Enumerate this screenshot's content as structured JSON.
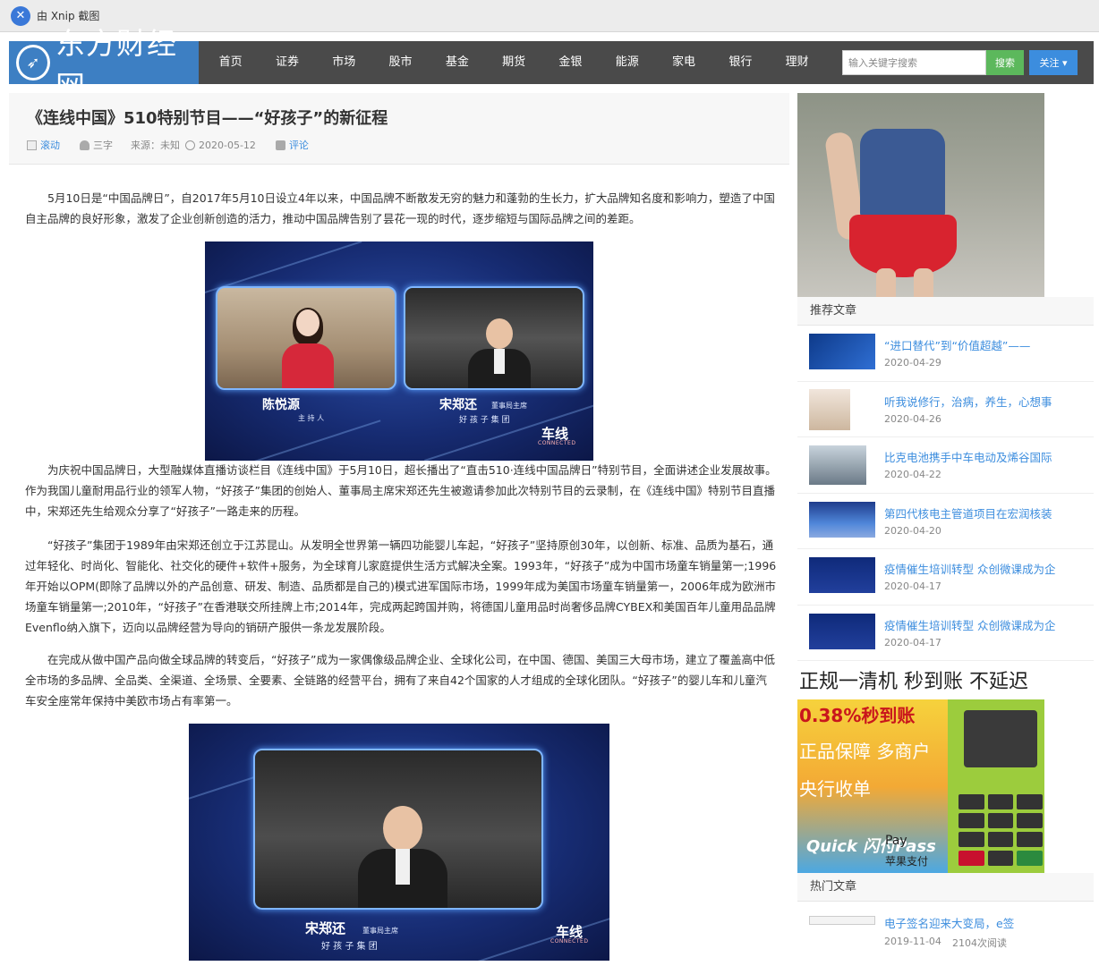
{
  "xnip": {
    "logo_glyph": "✕",
    "label": "由 Xnip 截图"
  },
  "site": {
    "logo_text": "东方财经网",
    "nav": [
      "首页",
      "证券",
      "市场",
      "股市",
      "基金",
      "期货",
      "金银",
      "能源",
      "家电",
      "银行",
      "理财"
    ],
    "search_placeholder": "输入关键字搜索",
    "search_label": "搜索",
    "follow_label": "关注 ▾"
  },
  "article": {
    "title": "《连线中国》510特别节目——“好孩子”的新征程",
    "meta": {
      "category": "滚动",
      "author": "三字",
      "source": "来源：未知",
      "date": "2020-05-12",
      "comment": "评论"
    },
    "paragraphs": [
      "5月10日是“中国品牌日”，自2017年5月10日设立4年以来，中国品牌不断散发无穷的魅力和蓬勃的生长力，扩大品牌知名度和影响力，塑造了中国自主品牌的良好形象，激发了企业创新创造的活力，推动中国品牌告别了昙花一现的时代，逐步缩短与国际品牌之间的差距。",
      "为庆祝中国品牌日，大型融媒体直播访谈栏目《连线中国》于5月10日，超长播出了“直击510·连线中国品牌日”特别节目，全面讲述企业发展故事。作为我国儿童耐用品行业的领军人物，“好孩子”集团的创始人、董事局主席宋郑还先生被邀请参加此次特别节目的云录制，在《连线中国》特别节目直播中，宋郑还先生给观众分享了“好孩子”一路走来的历程。",
      "“好孩子”集团于1989年由宋郑还创立于江苏昆山。从发明全世界第一辆四功能婴儿车起，“好孩子”坚持原创30年，以创新、标准、品质为基石，通过年轻化、时尚化、智能化、社交化的硬件+软件+服务，为全球育儿家庭提供生活方式解决全案。1993年，“好孩子”成为中国市场童车销量第一;1996年开始以OPM(即除了品牌以外的产品创意、研发、制造、品质都是自己的)模式进军国际市场，1999年成为美国市场童车销量第一，2006年成为欧洲市场童车销量第一;2010年，“好孩子”在香港联交所挂牌上市;2014年，完成两起跨国并购，将德国儿童用品时尚奢侈品牌CYBEX和美国百年儿童用品品牌Evenflo纳入旗下，迈向以品牌经营为导向的销研产服供一条龙发展阶段。",
      "在完成从做中国产品向做全球品牌的转变后，“好孩子”成为一家偶像级品牌企业、全球化公司，在中国、德国、美国三大母市场，建立了覆盖高中低全市场的多品牌、全品类、全渠道、全场景、全要素、全链路的经营平台，拥有了来自42个国家的人才组成的全球化团队。“好孩子”的婴儿车和儿童汽车安全座常年保持中美欧市场占有率第一。"
    ],
    "image1": {
      "host_name": "陈悦源",
      "host_role": "主 持 人",
      "guest_name": "宋郑还",
      "guest_role": "董事局主席",
      "guest_org": "好 孩 子 集 团",
      "brand": "车线",
      "brand_sub": "CONNECTED"
    },
    "image2": {
      "guest_name": "宋郑还",
      "guest_role": "董事局主席",
      "guest_org": "好 孩 子 集 团",
      "brand": "车线",
      "brand_sub": "CONNECTED"
    }
  },
  "sidebar": {
    "recommended_title": "推荐文章",
    "recommended": [
      {
        "title": "“进口替代”到“价值超越”——",
        "date": "2020-04-29",
        "thumb": "blue"
      },
      {
        "title": "听我说修行，治病，养生，心想事",
        "date": "2020-04-26",
        "thumb": "person"
      },
      {
        "title": "比克电池携手中车电动及烯谷国际",
        "date": "2020-04-22",
        "thumb": "room"
      },
      {
        "title": "第四代核电主管道项目在宏润核装",
        "date": "2020-04-20",
        "thumb": "event"
      },
      {
        "title": "疫情催生培训转型 众创微课成为企",
        "date": "2020-04-17",
        "thumb": "dark"
      },
      {
        "title": "疫情催生培训转型 众创微课成为企",
        "date": "2020-04-17",
        "thumb": "dark"
      }
    ],
    "pos_ad": {
      "headline": "正规一清机 秒到账 不延迟",
      "line1": "0.38%秒到账",
      "line2": "正品保障 多商户",
      "line3": "央行收单",
      "quick": "Quick 闪付Pass",
      "apple": " Pay",
      "apple_cn": "苹果支付"
    },
    "hot_title": "热门文章",
    "hot": [
      {
        "title": "电子签名迎来大变局，e签",
        "date": "2019-11-04",
        "views": "2104次阅读"
      }
    ]
  }
}
